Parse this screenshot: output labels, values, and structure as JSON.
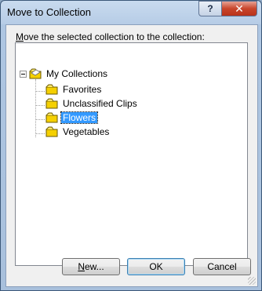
{
  "window": {
    "title": "Move to Collection"
  },
  "titlebar": {
    "help_label": "?",
    "close_label": "✕"
  },
  "instruction": {
    "accel": "M",
    "rest": "ove the selected collection to the collection:"
  },
  "tree": {
    "root": {
      "label": "My Collections",
      "expanded": true,
      "icon": "folder-icon"
    },
    "children": [
      {
        "label": "Favorites",
        "icon": "folder-icon",
        "selected": false
      },
      {
        "label": "Unclassified Clips",
        "icon": "folder-icon",
        "selected": false
      },
      {
        "label": "Flowers",
        "icon": "folder-icon",
        "selected": true
      },
      {
        "label": "Vegetables",
        "icon": "folder-icon",
        "selected": false
      }
    ]
  },
  "buttons": {
    "new_accel": "N",
    "new_rest": "ew...",
    "ok": "OK",
    "cancel": "Cancel"
  },
  "colors": {
    "selection": "#3399ff",
    "folder": "#f5d000",
    "close": "#c9462c"
  }
}
